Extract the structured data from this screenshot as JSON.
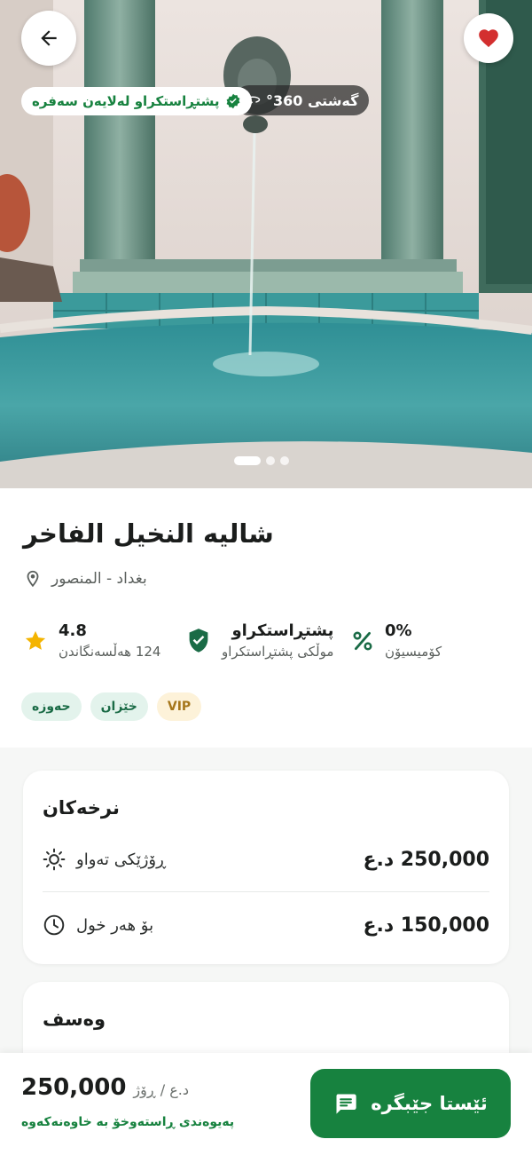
{
  "hero": {
    "tour_label": "گەشتی 360°",
    "verified_label": "پشتڕاستکراو لەلایەن سەفرە",
    "gallery_count": 3,
    "gallery_active": 0
  },
  "listing": {
    "title": "شاليه النخيل الفاخر",
    "location": "بغداد - المنصور",
    "rating": "4.8",
    "reviews_label": "124 هەڵسەنگاندن",
    "verified_title": "پشتڕاستکراو",
    "verified_sub": "موڵکی پشتڕاستکراو",
    "commission_value": "0%",
    "commission_label": "کۆمیسیۆن",
    "tags": [
      "VIP",
      "خێزان",
      "حەوزە"
    ]
  },
  "prices": {
    "title": "نرخەکان",
    "rows": [
      {
        "label": "ڕۆژێکی تەواو",
        "price": "250,000 د.ع",
        "icon": "sun-icon"
      },
      {
        "label": "بۆ هەر خول",
        "price": "150,000 د.ع",
        "icon": "clock-icon"
      }
    ]
  },
  "description": {
    "title": "وەسف"
  },
  "bottom_bar": {
    "price": "250,000",
    "unit": "د.ع / ڕۆژ",
    "contact_note": "پەیوەندی ڕاستەوخۆ بە خاوەنەکەوە",
    "book_label": "ئێستا جێبگرە"
  },
  "colors": {
    "brand_green": "#17823f",
    "favorite_red": "#d32f2f",
    "rating_star": "#f4b400"
  }
}
